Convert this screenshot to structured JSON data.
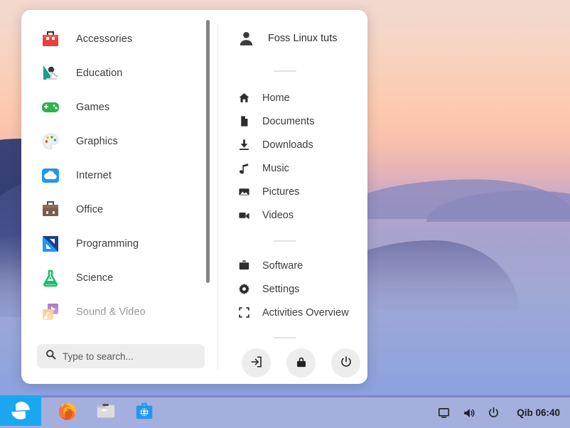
{
  "desktop": {
    "wallpaper_name": "sunset-hills-fog-wallpaper",
    "colors": {
      "sky_top": "#f2d8cf",
      "sky_mid": "#fbcdb4",
      "haze": "#b2a5cf",
      "hill_dark": "#3b4376",
      "fog_blue": "#8ba3e0",
      "taskbar": "#aab2dd",
      "taskbar_border": "#7d85c4",
      "start_accent": "#1aa7f0",
      "panel_bg": "#ffffff"
    }
  },
  "menu": {
    "categories": [
      {
        "label": "Accessories",
        "icon": "toolbox-icon"
      },
      {
        "label": "Education",
        "icon": "education-icon"
      },
      {
        "label": "Games",
        "icon": "gamepad-icon"
      },
      {
        "label": "Graphics",
        "icon": "palette-icon"
      },
      {
        "label": "Internet",
        "icon": "cloud-icon"
      },
      {
        "label": "Office",
        "icon": "briefcase-icon"
      },
      {
        "label": "Programming",
        "icon": "programming-icon"
      },
      {
        "label": "Science",
        "icon": "flask-icon"
      },
      {
        "label": "Sound & Video",
        "icon": "music-video-icon"
      }
    ],
    "search": {
      "placeholder": "Type to search...",
      "value": "",
      "icon": "search-icon"
    },
    "scrollbar": {
      "name": "category-scrollbar"
    },
    "user": {
      "name": "Foss Linux tuts",
      "avatar_icon": "person-icon"
    },
    "places": [
      {
        "label": "Home",
        "icon": "home-icon"
      },
      {
        "label": "Documents",
        "icon": "document-icon"
      },
      {
        "label": "Downloads",
        "icon": "download-icon"
      },
      {
        "label": "Music",
        "icon": "music-note-icon"
      },
      {
        "label": "Pictures",
        "icon": "image-icon"
      },
      {
        "label": "Videos",
        "icon": "video-camera-icon"
      }
    ],
    "system": [
      {
        "label": "Software",
        "icon": "briefcase-solid-icon"
      },
      {
        "label": "Settings",
        "icon": "gear-icon"
      },
      {
        "label": "Activities Overview",
        "icon": "expand-icon"
      }
    ],
    "session_actions": [
      {
        "name": "log-out-button",
        "icon": "logout-icon",
        "title": "Log Out"
      },
      {
        "name": "lock-button",
        "icon": "lock-icon",
        "title": "Lock"
      },
      {
        "name": "power-button",
        "icon": "power-icon",
        "title": "Power Off"
      }
    ]
  },
  "taskbar": {
    "start": {
      "name": "zorin-start-button",
      "icon": "zorin-logo-icon"
    },
    "launchers": [
      {
        "name": "firefox",
        "icon": "firefox-icon"
      },
      {
        "name": "files",
        "icon": "file-manager-icon"
      },
      {
        "name": "software",
        "icon": "software-store-icon"
      }
    ],
    "tray": [
      {
        "name": "display-icon"
      },
      {
        "name": "volume-icon"
      },
      {
        "name": "power-tray-icon"
      }
    ],
    "clock": "Qib 06:40"
  }
}
